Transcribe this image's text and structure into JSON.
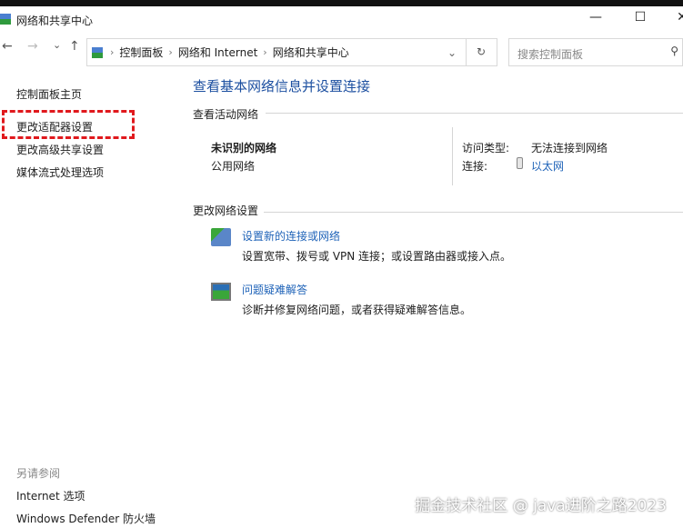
{
  "window": {
    "title": "网络和共享中心",
    "minimize": "—",
    "maximize": "☐",
    "close": "✕"
  },
  "nav": {
    "back": "←",
    "forward": "→",
    "recent": "⌄",
    "up": "↑",
    "refresh": "↻",
    "dropdown": "⌄"
  },
  "breadcrumb": [
    "控制面板",
    "网络和 Internet",
    "网络和共享中心"
  ],
  "search": {
    "placeholder": "搜索控制面板",
    "icon": "⚲"
  },
  "sidebar": {
    "items": [
      "控制面板主页",
      "更改适配器设置",
      "更改高级共享设置",
      "媒体流式处理选项"
    ],
    "see_also_title": "另请参阅",
    "see_also": [
      "Internet 选项",
      "Windows Defender 防火墙"
    ]
  },
  "main": {
    "title": "查看基本网络信息并设置连接",
    "active_title": "查看活动网络",
    "network_name": "未识别的网络",
    "network_type": "公用网络",
    "access_label": "访问类型:",
    "access_value": "无法连接到网络",
    "conn_label": "连接:",
    "conn_value": "以太网",
    "change_title": "更改网络设置",
    "tasks": [
      {
        "label": "设置新的连接或网络",
        "desc": "设置宽带、拨号或 VPN 连接；或设置路由器或接入点。"
      },
      {
        "label": "问题疑难解答",
        "desc": "诊断并修复网络问题，或者获得疑难解答信息。"
      }
    ]
  },
  "watermark": "掘金技术社区 @ java进阶之路2023"
}
